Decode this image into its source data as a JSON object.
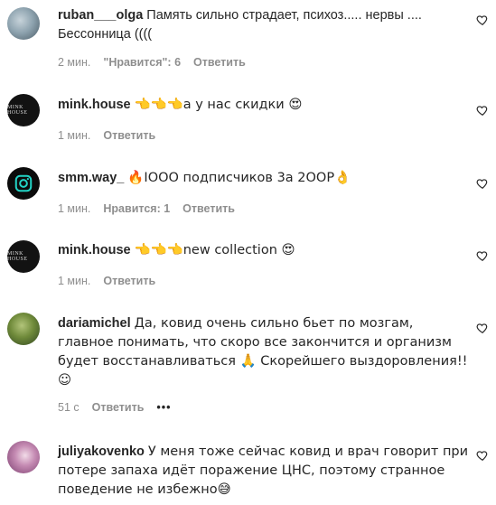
{
  "comments": [
    {
      "username": "ruban___olga",
      "text": "Память сильно страдает, психоз..... нервы .... Бессонница ((((",
      "time": "2 мин.",
      "likes": "\"Нравится\": 6",
      "reply": "Ответить",
      "avatar_icon": "profile-photo"
    },
    {
      "username": "mink.house",
      "text": "👈👈👈а у нас скидки 😍",
      "time": "1 мин.",
      "reply": "Ответить",
      "avatar_label": "MINK HOUSE"
    },
    {
      "username": "smm.way_",
      "text": "🔥IOOO подписчиков 3а 2OOР👌",
      "time": "1 мин.",
      "likes": "Нравится: 1",
      "reply": "Ответить",
      "avatar_icon": "instagram-logo-icon"
    },
    {
      "username": "mink.house",
      "text": "👈👈👈new collection 😍",
      "time": "1 мин.",
      "reply": "Ответить",
      "avatar_label": "MINK HOUSE"
    },
    {
      "username": "dariamichel",
      "text": "Да, ковид очень сильно бьет по мозгам, главное понимать, что скоро все закончится и организм будет восстанавливаться 🙏 Скорейшего выздоровления!! ☺",
      "time": "51 с",
      "reply": "Ответить",
      "more": "•••"
    },
    {
      "username": "juliyakovenko",
      "text": "У меня тоже сейчас ковид и врач говорит при потере запаха идёт поражение ЦНС, поэтому странное поведение не избежно😅"
    }
  ],
  "colors": {
    "text": "#262626",
    "secondary": "#8e8e8e"
  }
}
